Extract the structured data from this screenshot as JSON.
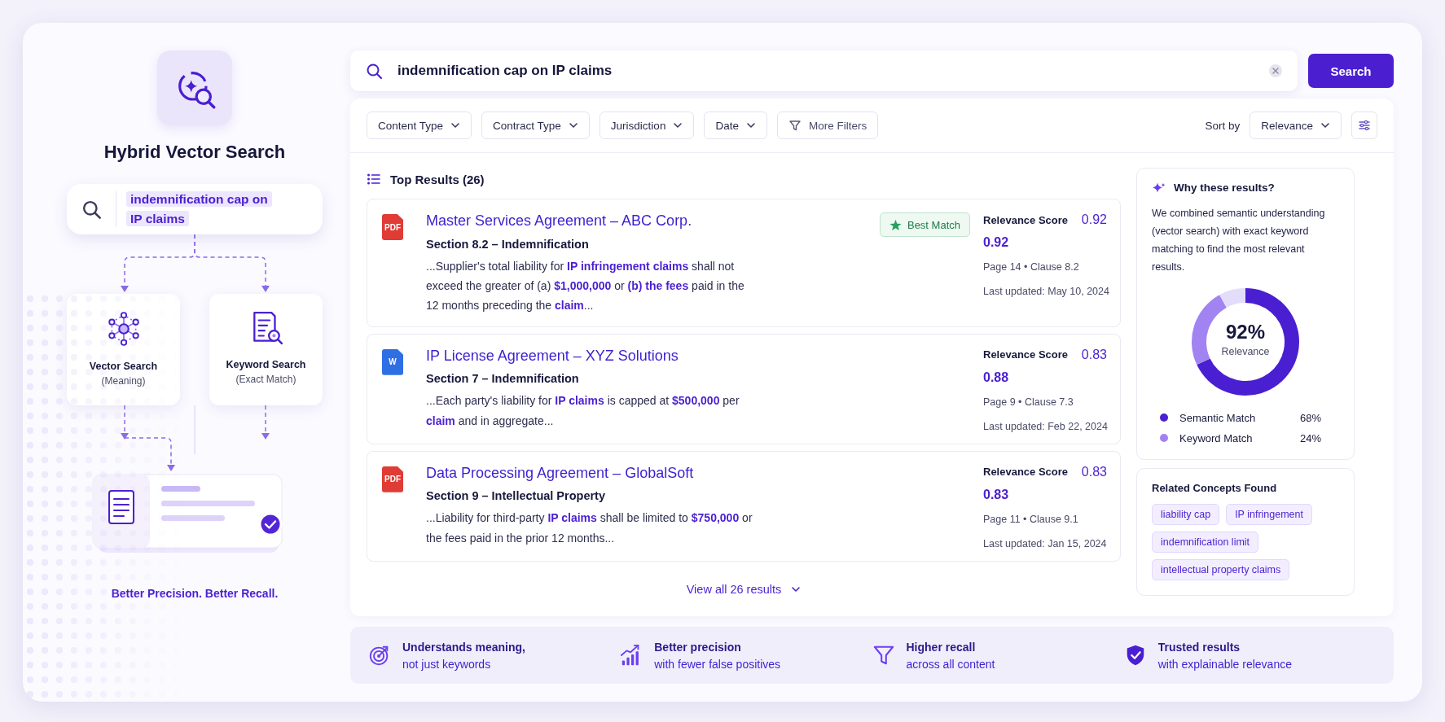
{
  "sidebar": {
    "title": "Hybrid Vector Search",
    "query": "indemnification cap on IP claims",
    "methods": [
      {
        "kind": "vector",
        "title": "Vector Search",
        "subtitle": "(Meaning)"
      },
      {
        "kind": "keyword",
        "title": "Keyword Search",
        "subtitle": "(Exact Match)"
      }
    ],
    "tagline": "Better Precision. Better Recall."
  },
  "search": {
    "value": "indemnification cap on IP claims",
    "button": "Search"
  },
  "filters": [
    {
      "kind": "dropdown",
      "label": "Content Type"
    },
    {
      "kind": "dropdown",
      "label": "Contract Type"
    },
    {
      "kind": "dropdown",
      "label": "Jurisdiction"
    },
    {
      "kind": "dropdown",
      "label": "Date"
    },
    {
      "kind": "more",
      "label": "More Filters"
    }
  ],
  "sort": {
    "label": "Sort by",
    "value": "Relevance"
  },
  "results": {
    "heading": "Top Results (26)",
    "items": [
      {
        "color": "#e03b35",
        "file_label": "PDF",
        "title": "Master Services Agreement – ABC Corp.",
        "section": "Section 8.2 – Indemnification",
        "snippet": "...Supplier's total liability for **IP infringement claims** shall not exceed the greater of (a) **$1,000,000** or **(b) the fees** paid in the 12 months preceding the **claim**...",
        "badge": "Best Match",
        "score_label": "Relevance Score",
        "score": "0.92",
        "score_2": "0.92",
        "location": "Page 14 • Clause 8.2",
        "updated": "Last updated: May 10, 2024"
      },
      {
        "color": "#2f6fe4",
        "file_label": "W",
        "title": "IP License Agreement – XYZ Solutions",
        "section": "Section 7 – Indemnification",
        "snippet": "...Each party's liability for **IP claims** is capped at **$500,000** per **claim** and in aggregate...",
        "score_label": "Relevance Score",
        "score": "0.83",
        "score_2": "0.88",
        "location": "Page 9 • Clause 7.3",
        "updated": "Last updated: Feb 22, 2024"
      },
      {
        "color": "#e03b35",
        "file_label": "PDF",
        "title": "Data Processing Agreement – GlobalSoft",
        "section": "Section 9 – Intellectual Property",
        "snippet": "...Liability for third-party **IP claims** shall be limited to **$750,000** or the fees paid in the prior 12 months...",
        "score_label": "Relevance Score",
        "score": "0.83",
        "score_2": "0.83",
        "location": "Page 11 • Clause 9.1",
        "updated": "Last updated: Jan 15, 2024"
      }
    ],
    "view_all": "View all 26 results"
  },
  "why": {
    "title": "Why these results?",
    "text": "We combined semantic understanding (vector search) with exact keyword matching to find the most relevant results.",
    "center_value": "92%",
    "chart_data": {
      "type": "donut",
      "categories": [
        "Semantic Match",
        "Keyword Match",
        null
      ],
      "series": [
        {
          "name": "Relevance",
          "values": [
            68,
            24,
            8
          ]
        }
      ]
    },
    "legend": [
      {
        "value": "68%",
        "color": "#4a1fd1"
      },
      {
        "value": "24%",
        "color": "#a283f2"
      }
    ]
  },
  "concepts": {
    "title": "Related Concepts Found",
    "tags": [
      "liability cap",
      "IP infringement",
      "indemnification limit",
      "intellectual property claims"
    ]
  },
  "features": [
    {
      "kind": "target",
      "title": "Understands meaning,",
      "subtitle": "not just keywords"
    },
    {
      "kind": "chart",
      "title": "Better precision",
      "subtitle": "with fewer false positives"
    },
    {
      "kind": "funnel",
      "title": "Higher recall",
      "subtitle": "across all content"
    },
    {
      "kind": "shield",
      "title": "Trusted results",
      "subtitle": "with explainable relevance"
    }
  ]
}
